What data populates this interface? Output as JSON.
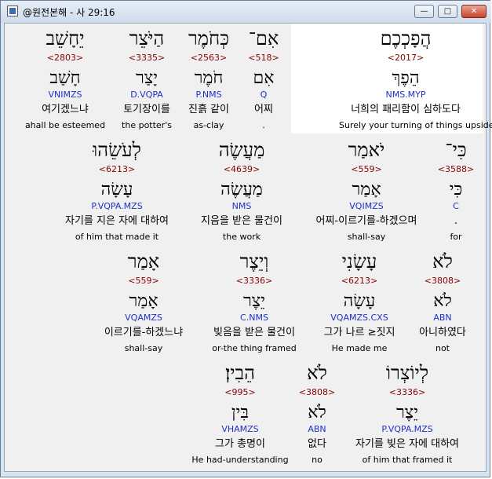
{
  "window": {
    "title": "@원전본해 - 사 29:16",
    "minimize_label": "—",
    "maximize_label": "□",
    "close_label": "✕"
  },
  "rows": [
    [
      {
        "hebrew": "הֲפָכְכֶם",
        "strong": "<2017>",
        "lemma": "הֵפֶךְ",
        "morph": "NMS.MYP",
        "korean": "너희의 패리함이 심하도다",
        "english": "Surely your turning of things upside dow"
      },
      {
        "hebrew": "אִם־",
        "strong": "<518>",
        "lemma": "אִם",
        "morph": "Q",
        "korean": "어찌",
        "english": "."
      },
      {
        "hebrew": "כְּחֹמֶר",
        "strong": "<2563>",
        "lemma": "חֹמֶר",
        "morph": "P.NMS",
        "korean": "진흙 같이",
        "english": "as-clay"
      },
      {
        "hebrew": "הַיֹּצֵר",
        "strong": "<3335>",
        "lemma": "יָצַר",
        "morph": "D.VQPA",
        "korean": "토기장이를",
        "english": "the potter's"
      },
      {
        "hebrew": "יֵחָשֵׁב",
        "strong": "<2803>",
        "lemma": "חָשַׁב",
        "morph": "VNIMZS",
        "korean": "여기겠느냐",
        "english": "ahall be esteemed"
      }
    ],
    [
      {
        "hebrew": "כִּי־",
        "strong": "<3588>",
        "lemma": "כִּי",
        "morph": "C",
        "korean": ".",
        "english": "for"
      },
      {
        "hebrew": "יֹאמַר",
        "strong": "<559>",
        "lemma": "אָמַר",
        "morph": "VQIMZS",
        "korean": "어찌-이르기를-하겠으며",
        "english": "shall-say"
      },
      {
        "hebrew": "מַעֲשֶׂה",
        "strong": "<4639>",
        "lemma": "מַעֲשֶׂה",
        "morph": "NMS",
        "korean": "지음을 받은 물건이",
        "english": "the work"
      },
      {
        "hebrew": "לְעֹשֵׂהוּ",
        "strong": "<6213>",
        "lemma": "עָשָׂה",
        "morph": "P.VQPA.MZS",
        "korean": "자기를 지은 자에 대하여",
        "english": "of him that made it"
      }
    ],
    [
      {
        "hebrew": "לֹא",
        "strong": "<3808>",
        "lemma": "לֹא",
        "morph": "ABN",
        "korean": "아니하였다",
        "english": "not"
      },
      {
        "hebrew": "עָשָׂנִי",
        "strong": "<6213>",
        "lemma": "עָשָׂה",
        "morph": "VQAMZS.CXS",
        "korean": "그가 나르 ≥짓지",
        "english": "He made me"
      },
      {
        "hebrew": "וְיֵצֶר",
        "strong": "<3336>",
        "lemma": "יֵצֶר",
        "morph": "C.NMS",
        "korean": "빚음을 받은 물건이",
        "english": "or-the thing framed"
      },
      {
        "hebrew": "אָמַר",
        "strong": "<559>",
        "lemma": "אָמַר",
        "morph": "VQAMZS",
        "korean": "이르기를-하겠느냐",
        "english": "shall-say"
      }
    ],
    [
      {
        "hebrew": "לְיוֹצְרוֹ",
        "strong": "<3336>",
        "lemma": "יֵצֶר",
        "morph": "P.VQPA.MZS",
        "korean": "자기를 빚은 자에 대하여",
        "english": "of him that framed it"
      },
      {
        "hebrew": "לֹא",
        "strong": "<3808>",
        "lemma": "לֹא",
        "morph": "ABN",
        "korean": "없다",
        "english": "no"
      },
      {
        "hebrew": "הֵבִין׃",
        "strong": "<995>",
        "lemma": "בִּין",
        "morph": "VHAMZS",
        "korean": "그가 총명이",
        "english": "He had-understanding"
      }
    ]
  ]
}
